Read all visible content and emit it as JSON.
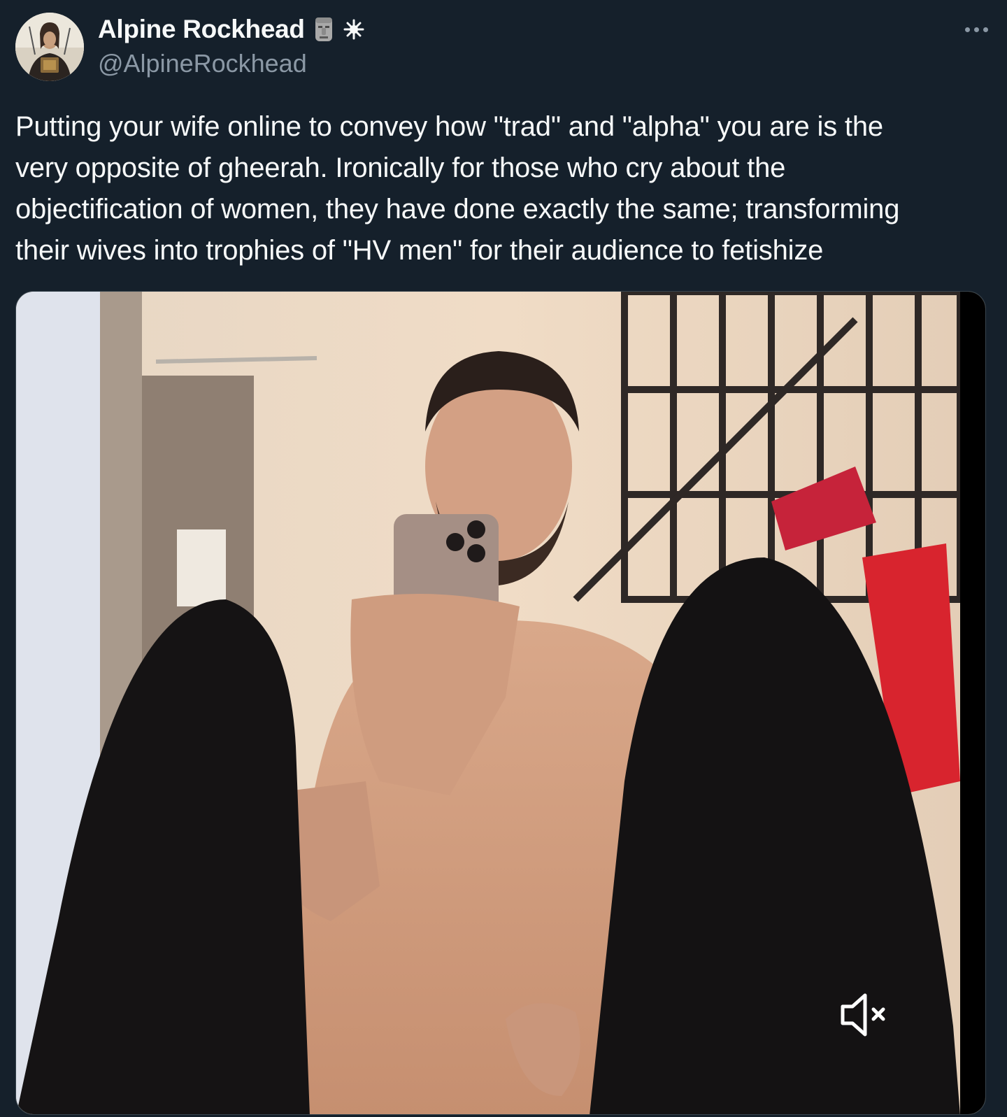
{
  "author": {
    "display_name": "Alpine Rockhead",
    "handle": "@AlpineRockhead",
    "badges": [
      "moai-emoji-icon",
      "sparkle-icon"
    ],
    "avatar_icon": "profile-avatar"
  },
  "more_menu": {
    "icon": "more-horizontal-icon"
  },
  "tweet": {
    "text": "Putting  your wife online to convey how \"trad\" and \"alpha\" you are is the\nvery opposite of gheerah. Ironically for those who cry about the\nobjectification of women, they have done exactly the same; transforming\ntheir wives into trophies of \"HV men\" for their audience to fetishize"
  },
  "media": {
    "type": "video",
    "mute_icon": "speaker-muted-icon"
  },
  "colors": {
    "background": "#15202b",
    "text_primary": "#f7f9f9",
    "text_secondary": "#8b98a5",
    "border": "#38444d"
  }
}
